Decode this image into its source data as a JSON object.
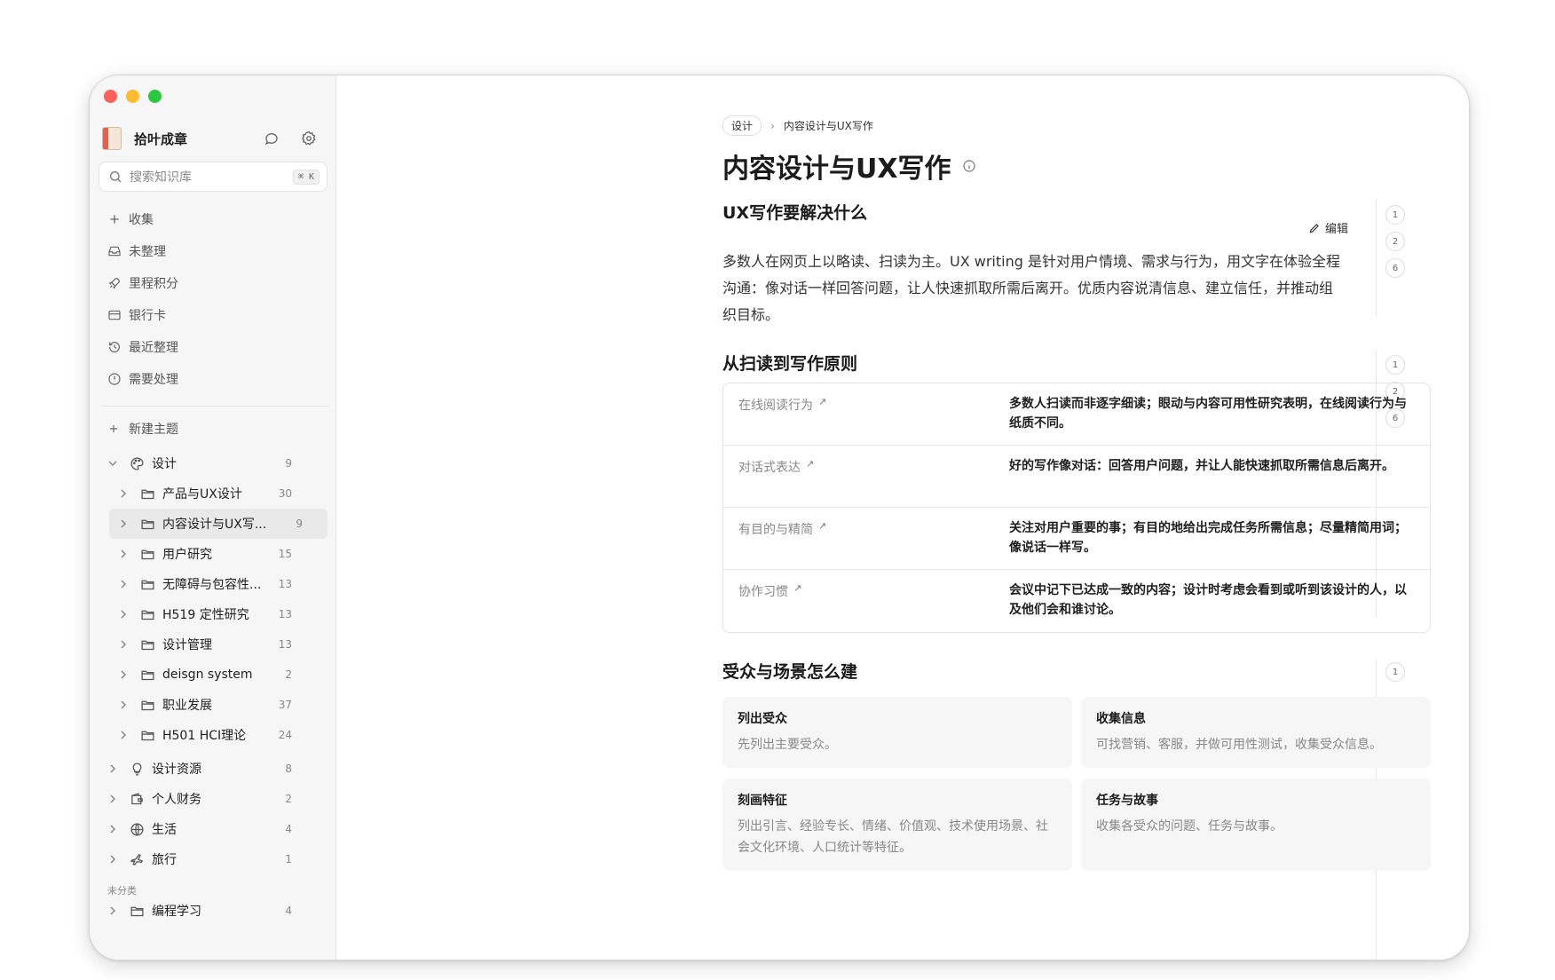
{
  "app": {
    "name": "拾叶成章"
  },
  "search": {
    "placeholder": "搜索知识库",
    "shortcut": "⌘ K"
  },
  "nav": [
    {
      "label": "收集",
      "icon": "plus-icon"
    },
    {
      "label": "未整理",
      "icon": "inbox-icon"
    },
    {
      "label": "里程积分",
      "icon": "rocket-icon"
    },
    {
      "label": "银行卡",
      "icon": "credit-card-icon"
    },
    {
      "label": "最近整理",
      "icon": "history-icon"
    },
    {
      "label": "需要处理",
      "icon": "alert-circle-icon"
    }
  ],
  "new_topic": "新建主题",
  "tree": {
    "design": {
      "label": "设计",
      "count": "9"
    },
    "design_children": [
      {
        "label": "产品与UX设计",
        "count": "30"
      },
      {
        "label": "内容设计与UX写...",
        "count": "9"
      },
      {
        "label": "用户研究",
        "count": "15"
      },
      {
        "label": "无障碍与包容性...",
        "count": "13"
      },
      {
        "label": "H519 定性研究",
        "count": "13"
      },
      {
        "label": "设计管理",
        "count": "13"
      },
      {
        "label": "deisgn system",
        "count": "2"
      },
      {
        "label": "职业发展",
        "count": "37"
      },
      {
        "label": "H501 HCI理论",
        "count": "24"
      }
    ],
    "topics": [
      {
        "label": "设计资源",
        "count": "8",
        "icon": "lightbulb-icon"
      },
      {
        "label": "个人财务",
        "count": "2",
        "icon": "wallet-icon"
      },
      {
        "label": "生活",
        "count": "4",
        "icon": "globe-icon"
      },
      {
        "label": "旅行",
        "count": "1",
        "icon": "airplane-icon"
      }
    ],
    "uncategorized_label": "未分类",
    "uncategorized": {
      "label": "编程学习",
      "count": "4"
    }
  },
  "breadcrumb": {
    "parent": "设计",
    "current": "内容设计与UX写作"
  },
  "page": {
    "title": "内容设计与UX写作"
  },
  "sections": {
    "s1": {
      "title": "UX写作要解决什么",
      "edit_label": "编辑",
      "paragraph": "多数人在网页上以略读、扫读为主。UX writing 是针对用户情境、需求与行为，用文字在体验全程沟通：像对话一样回答问题，让人快速抓取所需后离开。优质内容说清信息、建立信任，并推动组织目标。",
      "badges": [
        "1",
        "2",
        "6"
      ]
    },
    "s2": {
      "title": "从扫读到写作原则",
      "badges": [
        "1",
        "2",
        "6"
      ],
      "rows": [
        {
          "key": "在线阅读行为",
          "value": "多数人扫读而非逐字细读；眼动与内容可用性研究表明，在线阅读行为与纸质不同。"
        },
        {
          "key": "对话式表达",
          "value": "好的写作像对话：回答用户问题，并让人能快速抓取所需信息后离开。"
        },
        {
          "key": "有目的与精简",
          "value": "关注对用户重要的事；有目的地给出完成任务所需信息；尽量精简用词；像说话一样写。"
        },
        {
          "key": "协作习惯",
          "value": "会议中记下已达成一致的内容；设计时考虑会看到或听到该设计的人，以及他们会和谁讨论。"
        }
      ]
    },
    "s3": {
      "title": "受众与场景怎么建",
      "badges": [
        "1"
      ],
      "cards": [
        {
          "title": "列出受众",
          "desc": "先列出主要受众。"
        },
        {
          "title": "收集信息",
          "desc": "可找营销、客服，并做可用性测试，收集受众信息。"
        },
        {
          "title": "刻画特征",
          "desc": "列出引言、经验专长、情绪、价值观、技术使用场景、社会文化环境、人口统计等特征。"
        },
        {
          "title": "任务与故事",
          "desc": "收集各受众的问题、任务与故事。"
        }
      ]
    }
  }
}
